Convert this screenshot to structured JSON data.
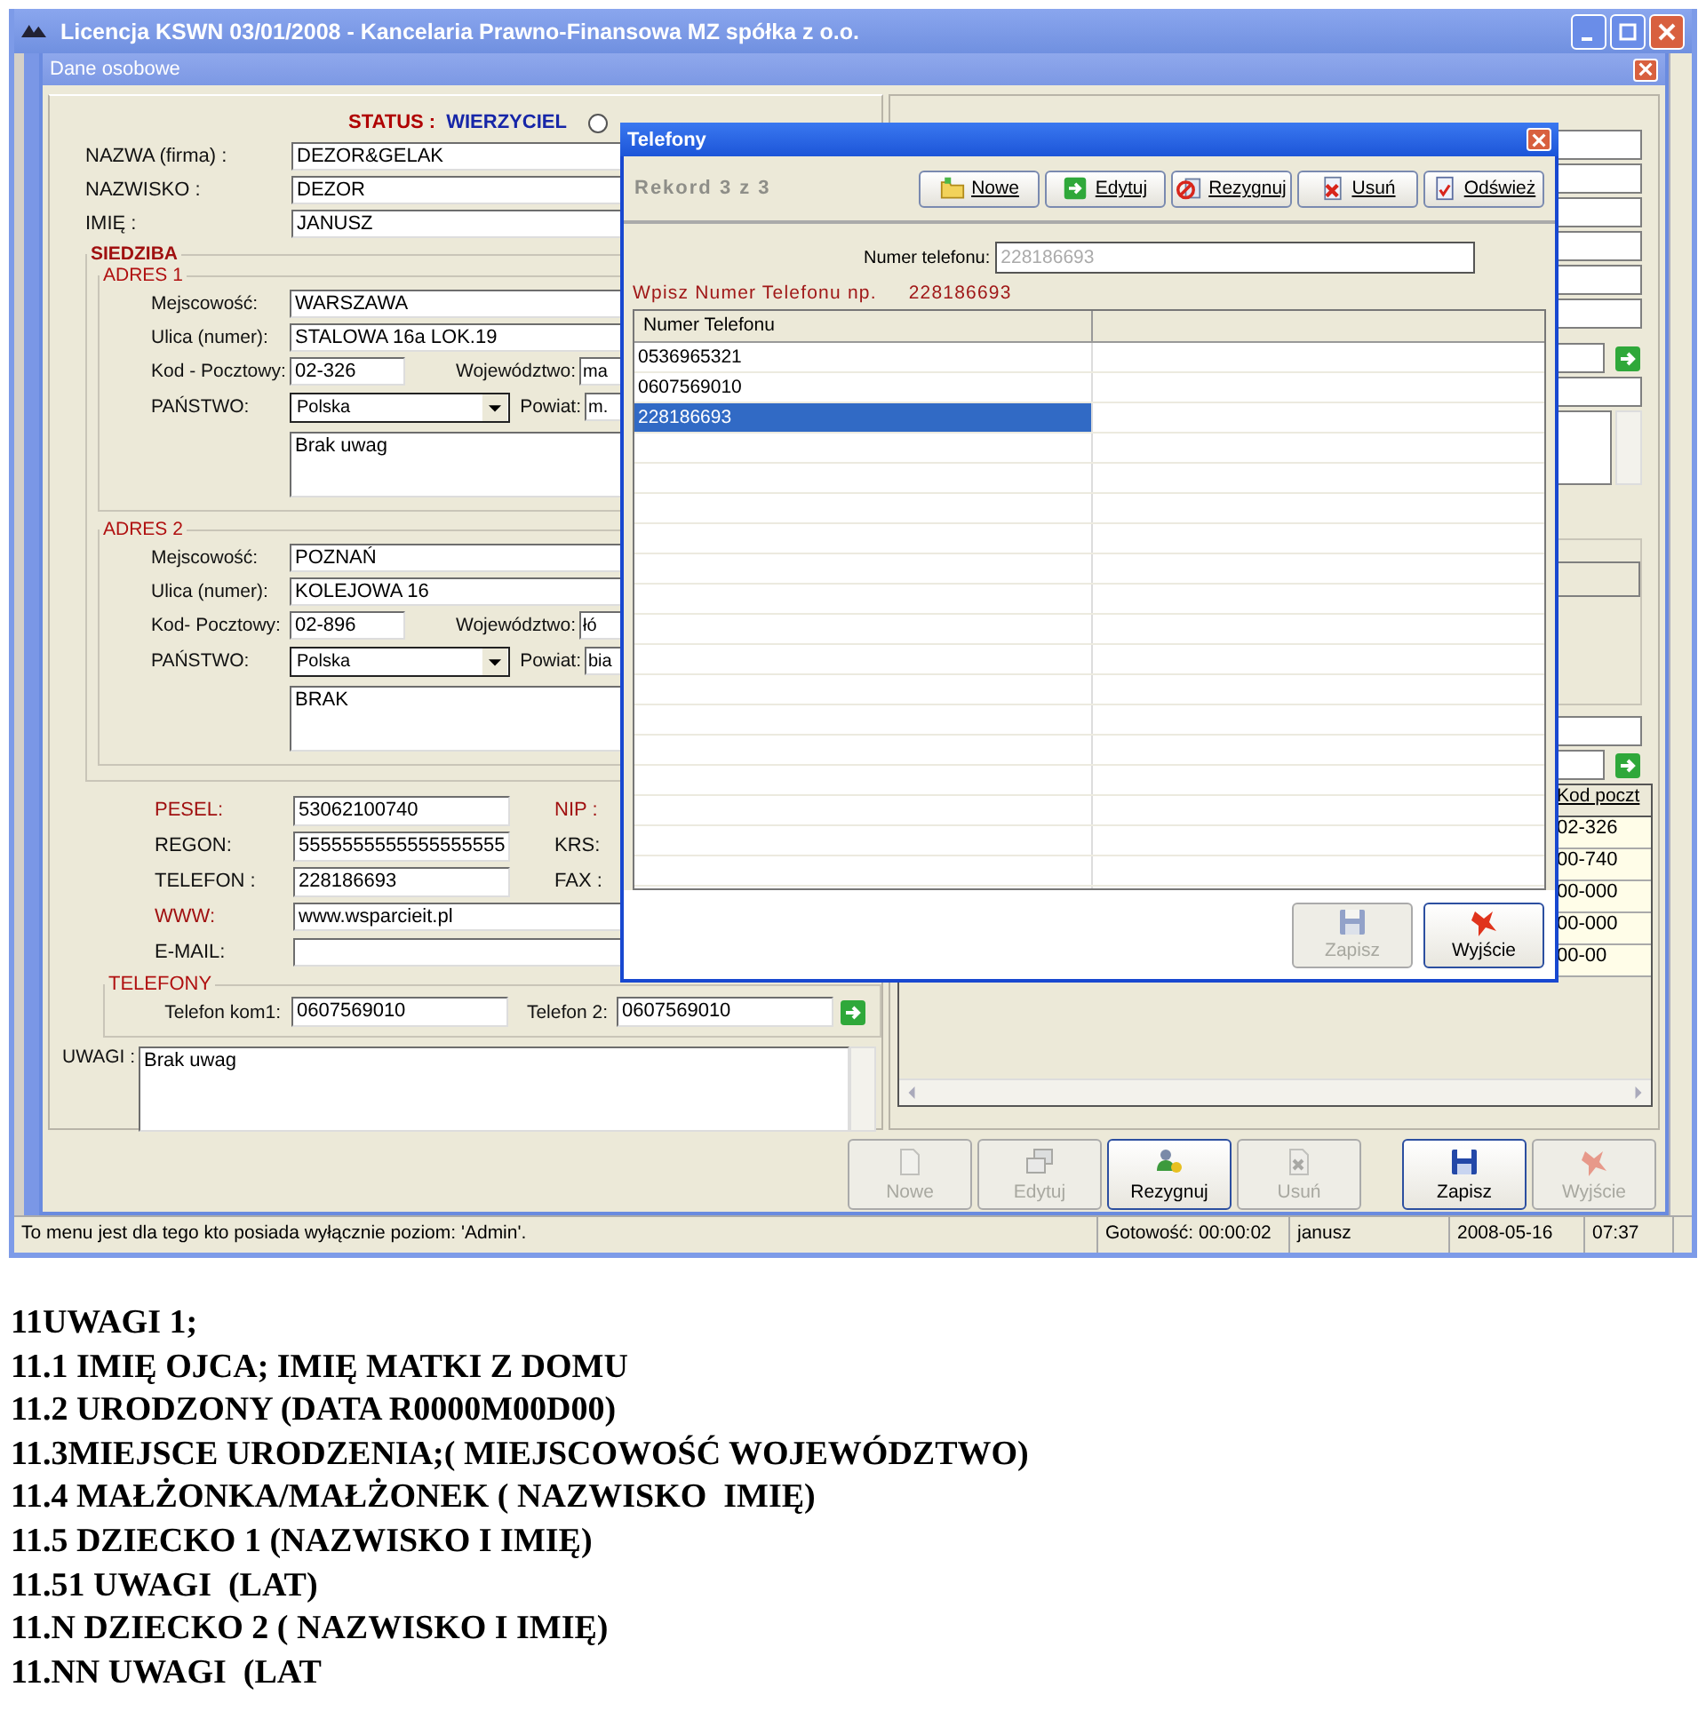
{
  "window": {
    "title": "Licencja KSWN 03/01/2008 - Kancelaria Prawno-Finansowa MZ spółka z o.o."
  },
  "child_window": {
    "title": "Dane osobowe"
  },
  "status": {
    "label": "STATUS :",
    "value": "WIERZYCIEL",
    "selected": false
  },
  "identity": [
    {
      "label": "NAZWA (firma) :",
      "value": "DEZOR&GELAK"
    },
    {
      "label": "NAZWISKO :",
      "value": "DEZOR"
    },
    {
      "label": "IMIĘ :",
      "value": "JANUSZ"
    }
  ],
  "seat": {
    "title": "SIEDZIBA",
    "addresses": [
      {
        "title": "ADRES 1",
        "city_label": "Mejscowość:",
        "city": "WARSZAWA",
        "street_label": "Ulica (numer):",
        "street": "STALOWA 16a LOK.19",
        "postal_label": "Kod - Pocztowy:",
        "postal": "02-326",
        "voivodeship_label": "Województwo:",
        "voivodeship": "ma",
        "country_label": "PAŃSTWO:",
        "country": "Polska",
        "district_label": "Powiat:",
        "district": "m.",
        "notes": "Brak uwag"
      },
      {
        "title": "ADRES 2",
        "city_label": "Mejscowość:",
        "city": "POZNAŃ",
        "street_label": "Ulica (numer):",
        "street": "KOLEJOWA 16",
        "postal_label": "Kod- Pocztowy:",
        "postal": "02-896",
        "voivodeship_label": "Województwo:",
        "voivodeship": "łó",
        "country_label": "PAŃSTWO:",
        "country": "Polska",
        "district_label": "Powiat:",
        "district": "bia",
        "notes": "BRAK"
      }
    ]
  },
  "ids": [
    {
      "label": "PESEL:",
      "value": "53062100740",
      "required": true,
      "kind": "short",
      "side_label": "NIP :",
      "side_required": true
    },
    {
      "label": "REGON:",
      "value": "5555555555555555555",
      "required": false,
      "kind": "short",
      "side_label": "KRS:",
      "side_required": false
    },
    {
      "label": "TELEFON :",
      "value": "228186693",
      "required": false,
      "kind": "short",
      "side_label": "FAX :",
      "side_required": false
    },
    {
      "label": "WWW:",
      "value": "www.wsparcieit.pl",
      "required": true,
      "kind": "wide"
    },
    {
      "label": "E-MAIL:",
      "required": false,
      "kind": "wide"
    }
  ],
  "phones": {
    "title": "TELEFONY",
    "items": [
      {
        "label": "Telefon kom1:",
        "value": "0607569010"
      },
      {
        "label": "Telefon 2:",
        "value": "0607569010"
      }
    ]
  },
  "notes": {
    "label": "UWAGI :",
    "value": "Brak uwag"
  },
  "postal_grid": {
    "columns": [
      "Kod poczt"
    ],
    "rows": [
      "02-326",
      "00-740",
      "00-000",
      "00-000",
      "00-00"
    ]
  },
  "toolbar": [
    {
      "label": "Nowe",
      "kind": "page",
      "disabled": true
    },
    {
      "label": "Edytuj",
      "kind": "windows",
      "disabled": true
    },
    {
      "label": "Rezygnuj",
      "kind": "people",
      "disabled": false
    },
    {
      "label": "Usuń",
      "kind": "trash",
      "disabled": true
    },
    {
      "label": "Zapisz",
      "kind": "save",
      "disabled": false
    },
    {
      "label": "Wyjście",
      "kind": "exit",
      "disabled": true
    }
  ],
  "status_bar": {
    "message": "To menu jest dla tego kto posiada wyłącznie poziom: 'Admin'.",
    "cells": [
      "Gotowość: 00:00:02",
      "janusz",
      "2008-05-16",
      "07:37"
    ]
  },
  "dialog": {
    "title": "Telefony",
    "record": "Rekord 3 z 3",
    "buttons": [
      {
        "label": "Nowe",
        "kind": "folder"
      },
      {
        "label": "Edytuj",
        "kind": "arrow"
      },
      {
        "label": "Rezygnuj",
        "kind": "cancel"
      },
      {
        "label": "Usuń",
        "kind": "delete"
      },
      {
        "label": "Odśwież",
        "kind": "refresh"
      }
    ],
    "field_label": "Numer telefonu:",
    "field_value": "228186693",
    "hint": "Wpisz Numer Telefonu np.",
    "hint_example": "228186693",
    "columns": [
      "Numer Telefonu"
    ],
    "rows": [
      {
        "number": "0536965321",
        "selected": false
      },
      {
        "number": "0607569010",
        "selected": false
      },
      {
        "number": "228186693",
        "selected": true
      }
    ],
    "footer_buttons": [
      {
        "label": "Zapisz",
        "kind": "save",
        "disabled": true
      },
      {
        "label": "Wyjście",
        "kind": "exit",
        "disabled": false
      }
    ]
  },
  "document_lines": [
    "11UWAGI 1;",
    "11.1 IMIĘ OJCA; IMIĘ MATKI Z DOMU",
    "11.2 URODZONY (DATA R0000M00D00)",
    "11.3MIEJSCE URODZENIA;( MIEJSCOWOŚĆ WOJEWÓDZTWO)",
    "11.4 MAŁŻONKA/MAŁŻONEK ( NAZWISKO  IMIĘ)",
    "11.5 DZIECKO 1 (NAZWISKO I IMIĘ)",
    "11.51 UWAGI  (LAT)",
    "11.N DZIECKO 2 ( NAZWISKO I IMIĘ)",
    "11.NN UWAGI  (LAT"
  ]
}
